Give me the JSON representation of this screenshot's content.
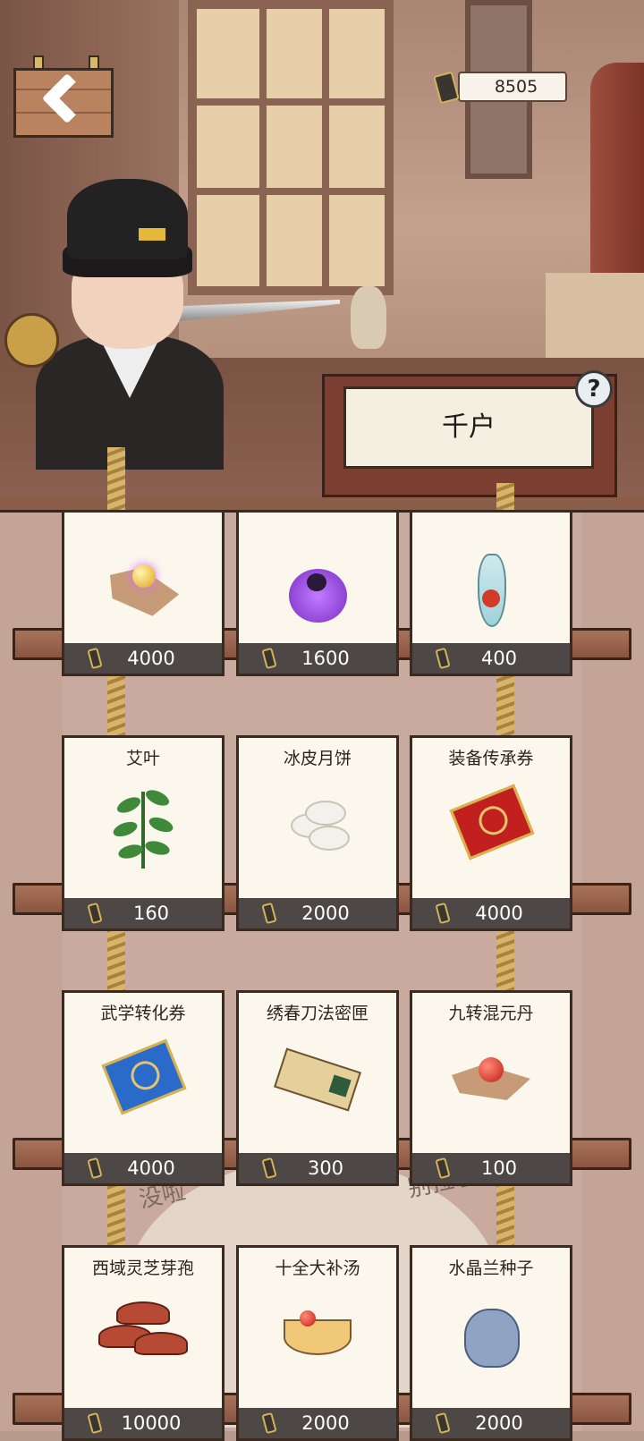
{
  "header": {
    "currency_amount": "8505",
    "rank_title": "千户",
    "help_label": "?"
  },
  "background_text": {
    "left": "没啦",
    "right": "别拉了"
  },
  "shop": {
    "items": [
      {
        "name": "",
        "price": "4000",
        "icon": "golden-orb-on-cloth-icon"
      },
      {
        "name": "",
        "price": "1600",
        "icon": "purple-poison-pouch-icon"
      },
      {
        "name": "",
        "price": "400",
        "icon": "elixir-bottle-icon"
      },
      {
        "name": "艾叶",
        "price": "160",
        "icon": "mugwort-leaf-icon"
      },
      {
        "name": "冰皮月饼",
        "price": "2000",
        "icon": "snowskin-mooncake-icon"
      },
      {
        "name": "装备传承券",
        "price": "4000",
        "icon": "red-coupon-icon"
      },
      {
        "name": "武学转化券",
        "price": "4000",
        "icon": "blue-coupon-icon"
      },
      {
        "name": "绣春刀法密匣",
        "price": "300",
        "icon": "secret-box-icon"
      },
      {
        "name": "九转混元丹",
        "price": "100",
        "icon": "red-pill-icon"
      },
      {
        "name": "西域灵芝芽孢",
        "price": "10000",
        "icon": "reishi-mushroom-icon"
      },
      {
        "name": "十全大补汤",
        "price": "2000",
        "icon": "tonic-soup-icon"
      },
      {
        "name": "水晶兰种子",
        "price": "2000",
        "icon": "seed-bag-icon"
      }
    ]
  }
}
